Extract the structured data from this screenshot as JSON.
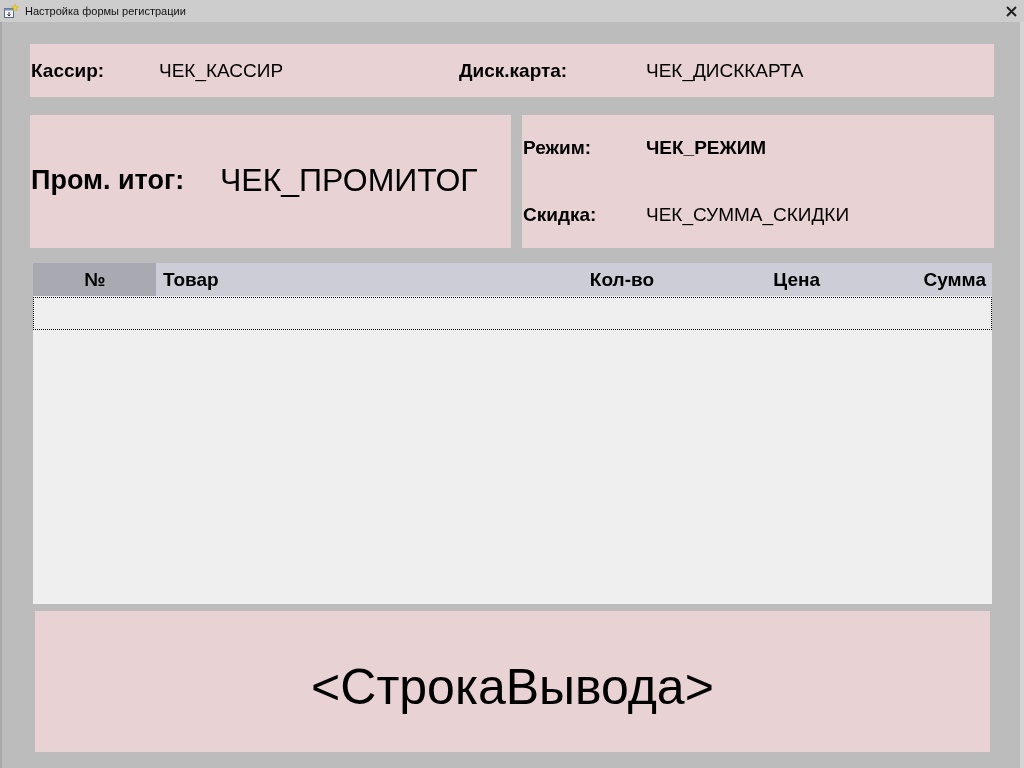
{
  "window": {
    "title": "Настройка формы регистрации"
  },
  "header_panel": {
    "fields": [
      {
        "label": "Кассир:",
        "value": "ЧЕК_КАССИР"
      },
      {
        "label": "Диск.карта:",
        "value": "ЧЕК_ДИСККАРТА"
      }
    ]
  },
  "total_panel": {
    "label": "Пром. итог:",
    "value": "ЧЕК_ПРОМИТОГ"
  },
  "mode_panel": {
    "fields": [
      {
        "label": "Режим:",
        "value": "ЧЕК_РЕЖИМ"
      },
      {
        "label": "Скидка:",
        "value": "ЧЕК_СУММА_СКИДКИ"
      }
    ]
  },
  "table": {
    "columns": [
      {
        "label": "№",
        "highlighted": true
      },
      {
        "label": "Товар",
        "highlighted": false
      },
      {
        "label": "Кол-во",
        "highlighted": false
      },
      {
        "label": "Цена",
        "highlighted": false
      },
      {
        "label": "Сумма",
        "highlighted": false
      }
    ],
    "rows": [
      {
        "selected": true
      }
    ]
  },
  "output_line": {
    "text": "<СтрокаВывода>"
  }
}
